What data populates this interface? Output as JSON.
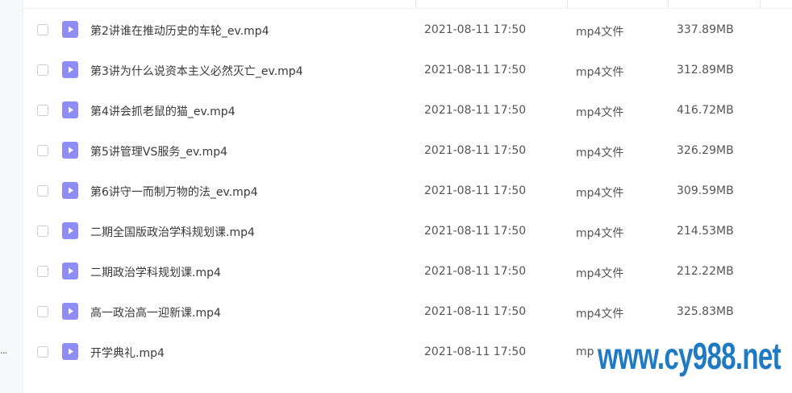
{
  "left_panel": {
    "ellipsis": "..."
  },
  "files": [
    {
      "name": "第2讲谁在推动历史的车轮_ev.mp4",
      "date": "2021-08-11 17:50",
      "type": "mp4文件",
      "size": "337.89MB"
    },
    {
      "name": "第3讲为什么说资本主义必然灭亡_ev.mp4",
      "date": "2021-08-11 17:50",
      "type": "mp4文件",
      "size": "312.89MB"
    },
    {
      "name": "第4讲会抓老鼠的猫_ev.mp4",
      "date": "2021-08-11 17:50",
      "type": "mp4文件",
      "size": "416.72MB"
    },
    {
      "name": "第5讲管理VS服务_ev.mp4",
      "date": "2021-08-11 17:50",
      "type": "mp4文件",
      "size": "326.29MB"
    },
    {
      "name": "第6讲守一而制万物的法_ev.mp4",
      "date": "2021-08-11 17:50",
      "type": "mp4文件",
      "size": "309.59MB"
    },
    {
      "name": "二期全国版政治学科规划课.mp4",
      "date": "2021-08-11 17:50",
      "type": "mp4文件",
      "size": "214.53MB"
    },
    {
      "name": "二期政治学科规划课.mp4",
      "date": "2021-08-11 17:50",
      "type": "mp4文件",
      "size": "212.22MB"
    },
    {
      "name": "高一政治高一迎新课.mp4",
      "date": "2021-08-11 17:50",
      "type": "mp4文件",
      "size": "325.83MB"
    },
    {
      "name": "开学典礼.mp4",
      "date": "2021-08-11 17:50",
      "type": "mp",
      "size": ""
    }
  ],
  "file_icon": "video-play-icon",
  "colors": {
    "icon_bg": "#8e8cf5",
    "watermark": "#1f7ac4"
  },
  "watermark": {
    "text": "www.cy988.net"
  }
}
